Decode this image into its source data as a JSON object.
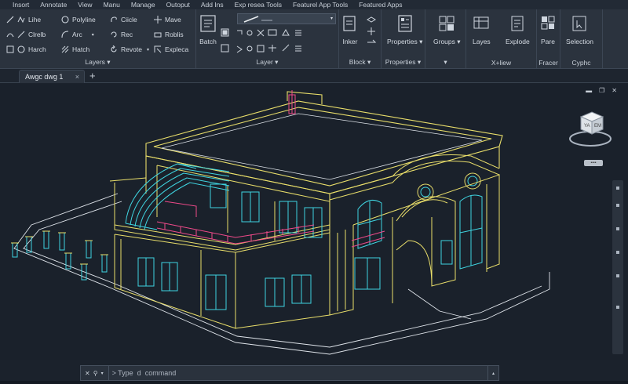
{
  "menu": [
    "Insort",
    "Annotate",
    "View",
    "Manu",
    "Manage",
    "Outoput",
    "Add Ins",
    "Exp resea Tools",
    "Featurel App Tools",
    "Featured Apps"
  ],
  "draw": {
    "col1": [
      "Lihe",
      "Clrelb",
      "Harch"
    ],
    "col2": [
      "Polyline",
      "Arc",
      "Hatch"
    ]
  },
  "modify": {
    "col1": [
      "Ciicle",
      "Rec",
      "Revote"
    ],
    "col2": [
      "Mave",
      "Roblis",
      "Expleca"
    ]
  },
  "panels": {
    "layers": "Layers",
    "layer": "Layer",
    "block": "Block",
    "properties": "Properties",
    "groups_title": "",
    "view": "X+liew",
    "fracer": "Fracer",
    "cyphc": "Cyphc"
  },
  "big_tools": {
    "batch": "Batch",
    "inker": "Inker",
    "properties": "Properties",
    "groups": "Groups",
    "layes": "Layes",
    "explode": "Explode",
    "pare": "Pare",
    "selection": "Selection"
  },
  "tabs": {
    "doc": "Awgc dwg 1",
    "close": "×",
    "new": "+"
  },
  "viewcube": {
    "top": "YA",
    "right": "EM",
    "button": "••••"
  },
  "command": {
    "placeholder": "> Type  d  command"
  },
  "colors": {
    "ribbon": "#2b333e",
    "canvas": "#1a212b",
    "yellow": "#e9de6a",
    "cyan": "#3fd4e0",
    "pink": "#f04a8a",
    "white": "#e8ecf0"
  }
}
